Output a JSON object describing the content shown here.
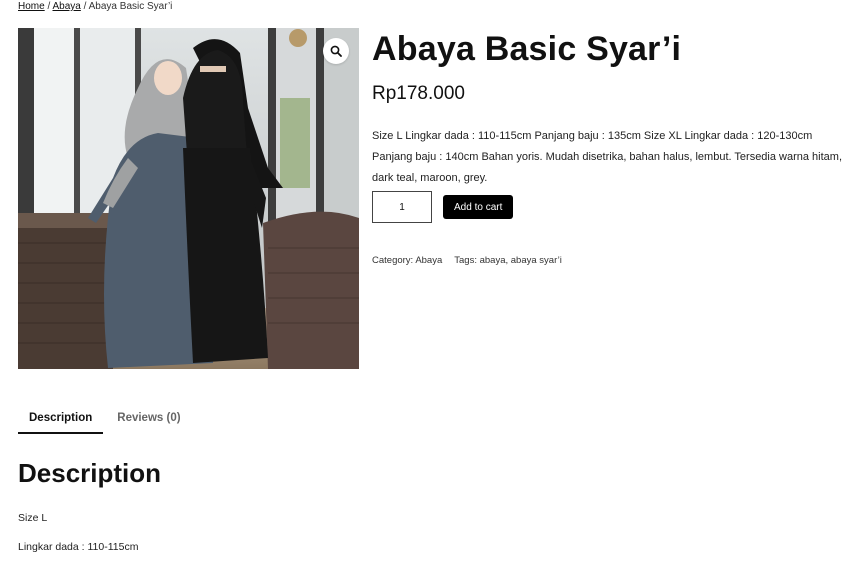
{
  "breadcrumb": {
    "home": "Home",
    "sep1": " / ",
    "category": "Abaya",
    "sep2": " / ",
    "current": "Abaya Basic Syar’i"
  },
  "product": {
    "title": "Abaya Basic Syar’i",
    "price": "Rp178.000",
    "short_description": "Size L Lingkar dada : 110-115cm Panjang baju : 135cm Size XL Lingkar dada : 120-130cm Panjang baju : 140cm   Bahan yoris. Mudah disetrika, bahan halus, lembut. Tersedia warna hitam, dark teal, maroon, grey.",
    "quantity": "1",
    "add_to_cart_label": "Add to cart",
    "image_icon": "zoom-magnifier-icon"
  },
  "meta": {
    "category_label": "Category: ",
    "category_value": "Abaya",
    "tags_label": "Tags: ",
    "tags_value": "abaya, abaya syar’i"
  },
  "tabs": [
    {
      "label": "Description",
      "active": true
    },
    {
      "label": "Reviews (0)",
      "active": false
    }
  ],
  "description_panel": {
    "heading": "Description",
    "lines": [
      "Size L",
      "Lingkar dada : 110-115cm"
    ]
  },
  "colors": {
    "button_bg": "#000000",
    "button_text": "#ffffff",
    "text": "#111111"
  }
}
